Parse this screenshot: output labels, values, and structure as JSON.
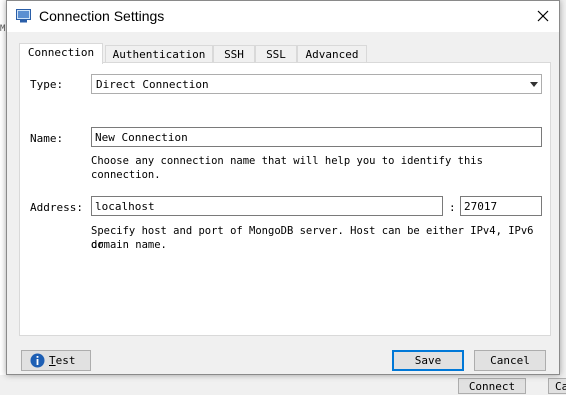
{
  "window": {
    "title": "Connection Settings",
    "icon": "app-window-icon",
    "close_icon": "close-icon"
  },
  "tabs": [
    {
      "label": "Connection",
      "active": true
    },
    {
      "label": "Authentication",
      "active": false
    },
    {
      "label": "SSH",
      "active": false
    },
    {
      "label": "SSL",
      "active": false
    },
    {
      "label": "Advanced",
      "active": false
    }
  ],
  "connection": {
    "type_label": "Type:",
    "type_value": "Direct Connection",
    "name_label": "Name:",
    "name_value": "New Connection",
    "name_hint": "Choose any connection name that will help you to identify this connection.",
    "address_label": "Address:",
    "host_value": "localhost",
    "port_separator": ":",
    "port_value": "27017",
    "address_hint_line1": "Specify host and port of MongoDB server. Host can be either IPv4, IPv6 or",
    "address_hint_line2": "domain name."
  },
  "footer": {
    "test_label_underlined": "T",
    "test_label_rest": "est",
    "save_label": "Save",
    "cancel_label": "Cancel"
  },
  "background": {
    "connect_label": "Connect",
    "ca_fragment": "Ca",
    "left_fragment": "M"
  },
  "colors": {
    "accent": "#0078d7",
    "info_icon": "#1e5fb4"
  }
}
